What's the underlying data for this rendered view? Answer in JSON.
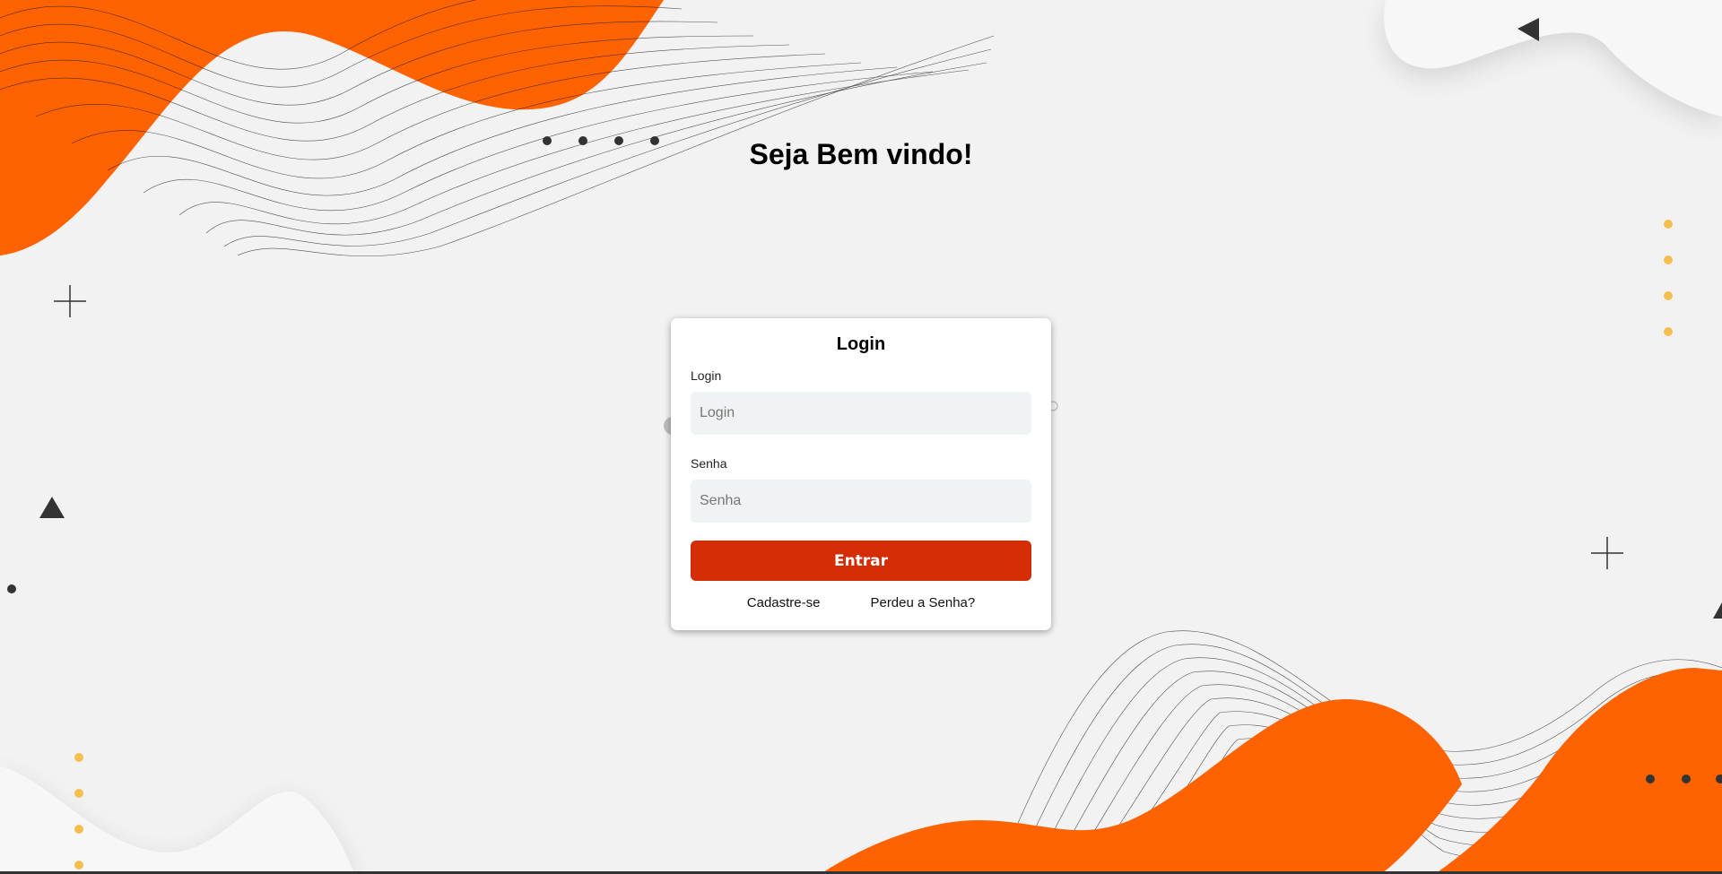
{
  "header": {
    "welcome_title": "Seja Bem vindo!"
  },
  "login_form": {
    "title": "Login",
    "login_label": "Login",
    "login_placeholder": "Login",
    "login_value": "",
    "password_label": "Senha",
    "password_placeholder": "Senha",
    "password_value": "",
    "submit_label": "Entrar",
    "register_link": "Cadastre-se",
    "forgot_password_link": "Perdeu a Senha?"
  },
  "colors": {
    "background": "#f2f2f2",
    "accent_orange": "#ff6200",
    "button_red": "#d42d06",
    "dot_yellow": "#f5bf4f",
    "dark_shape": "#333333"
  }
}
